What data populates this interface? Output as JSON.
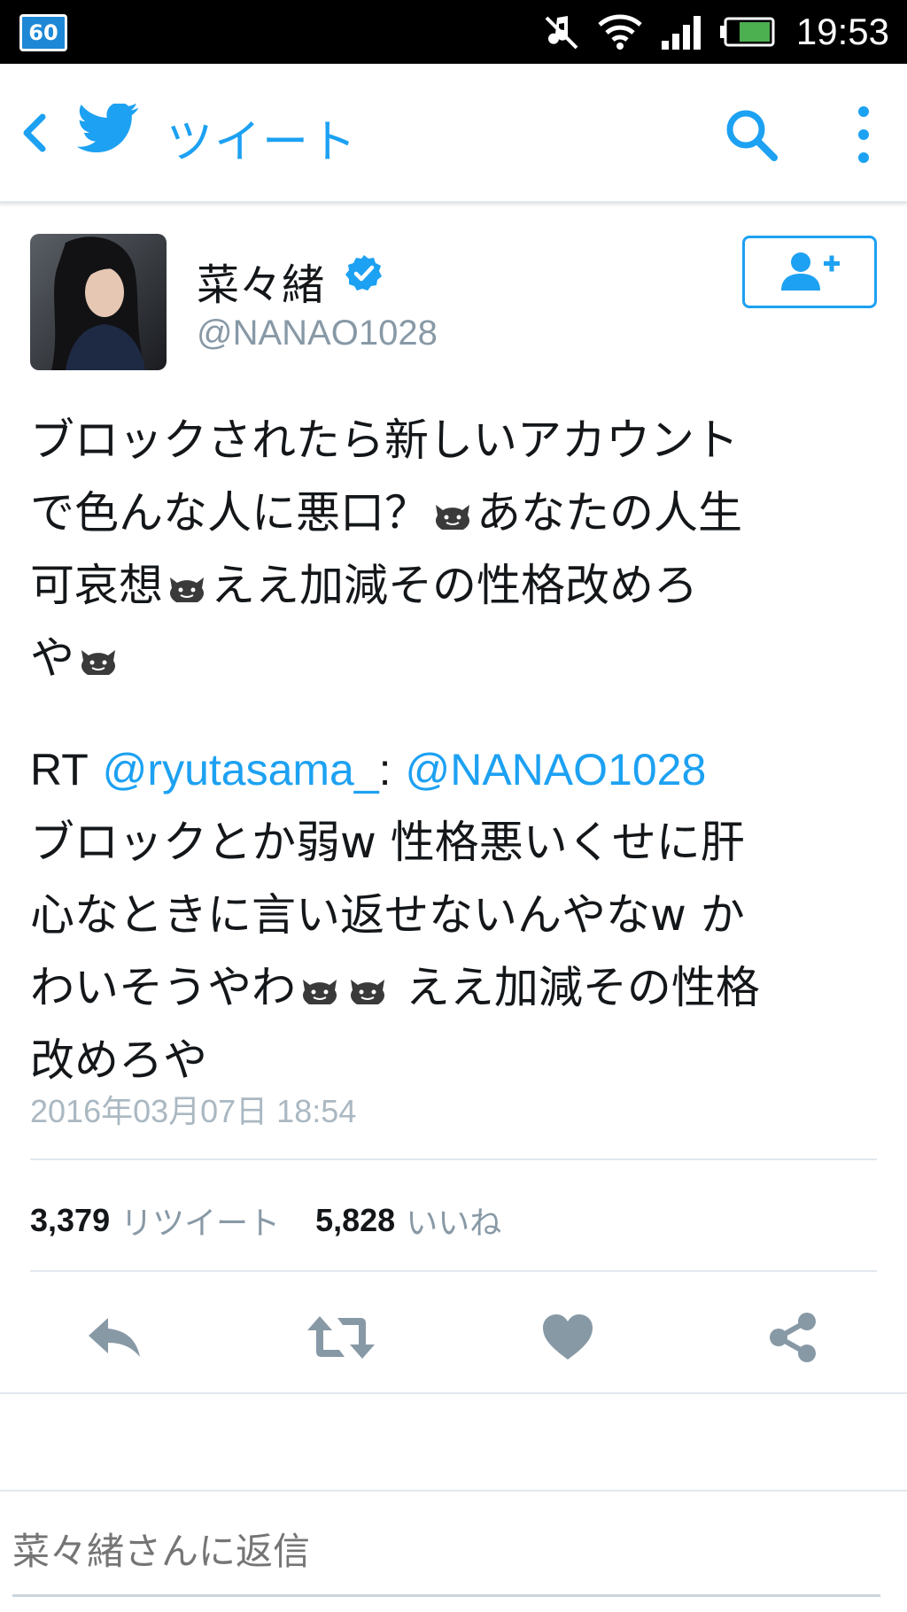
{
  "status_bar": {
    "badge": "60",
    "time": "19:53"
  },
  "toolbar": {
    "title": "ツイート"
  },
  "tweet": {
    "display_name": "菜々緒",
    "handle": "@NANAO1028",
    "body_lines": [
      "ブロックされたら新しいアカウント",
      "で色んな人に悪口？",
      "あなたの人生",
      "可哀想",
      "ええ加減その性格改めろ",
      "や"
    ],
    "rt": {
      "prefix": "RT",
      "mention1": "@ryutasama_",
      "colon": ":",
      "mention2": "@NANAO1028",
      "line2": "ブロックとか弱w 性格悪いくせに肝",
      "line3": "心なときに言い返せないんやなw か",
      "line4a": "わいそうやわ",
      "line4b": "ええ加減その性格",
      "line5": "改めろや"
    },
    "timestamp": "2016年03月07日 18:54",
    "retweet_count": "3,379",
    "retweet_label": "リツイート",
    "like_count": "5,828",
    "like_label": "いいね"
  },
  "reply": {
    "placeholder": "菜々緒さんに返信"
  },
  "colors": {
    "accent": "#1da1f2",
    "icon_gray": "#8899a6",
    "text_dark": "#14171a"
  },
  "icons": {
    "back": "chevron-left-icon",
    "logo": "twitter-bird-icon",
    "search": "search-icon",
    "more": "more-vertical-icon",
    "verified": "verified-badge-icon",
    "follow": "follow-user-icon",
    "reply": "reply-icon",
    "retweet": "retweet-icon",
    "like": "heart-icon",
    "share": "share-icon",
    "emoji": "devil-face-emoji"
  }
}
